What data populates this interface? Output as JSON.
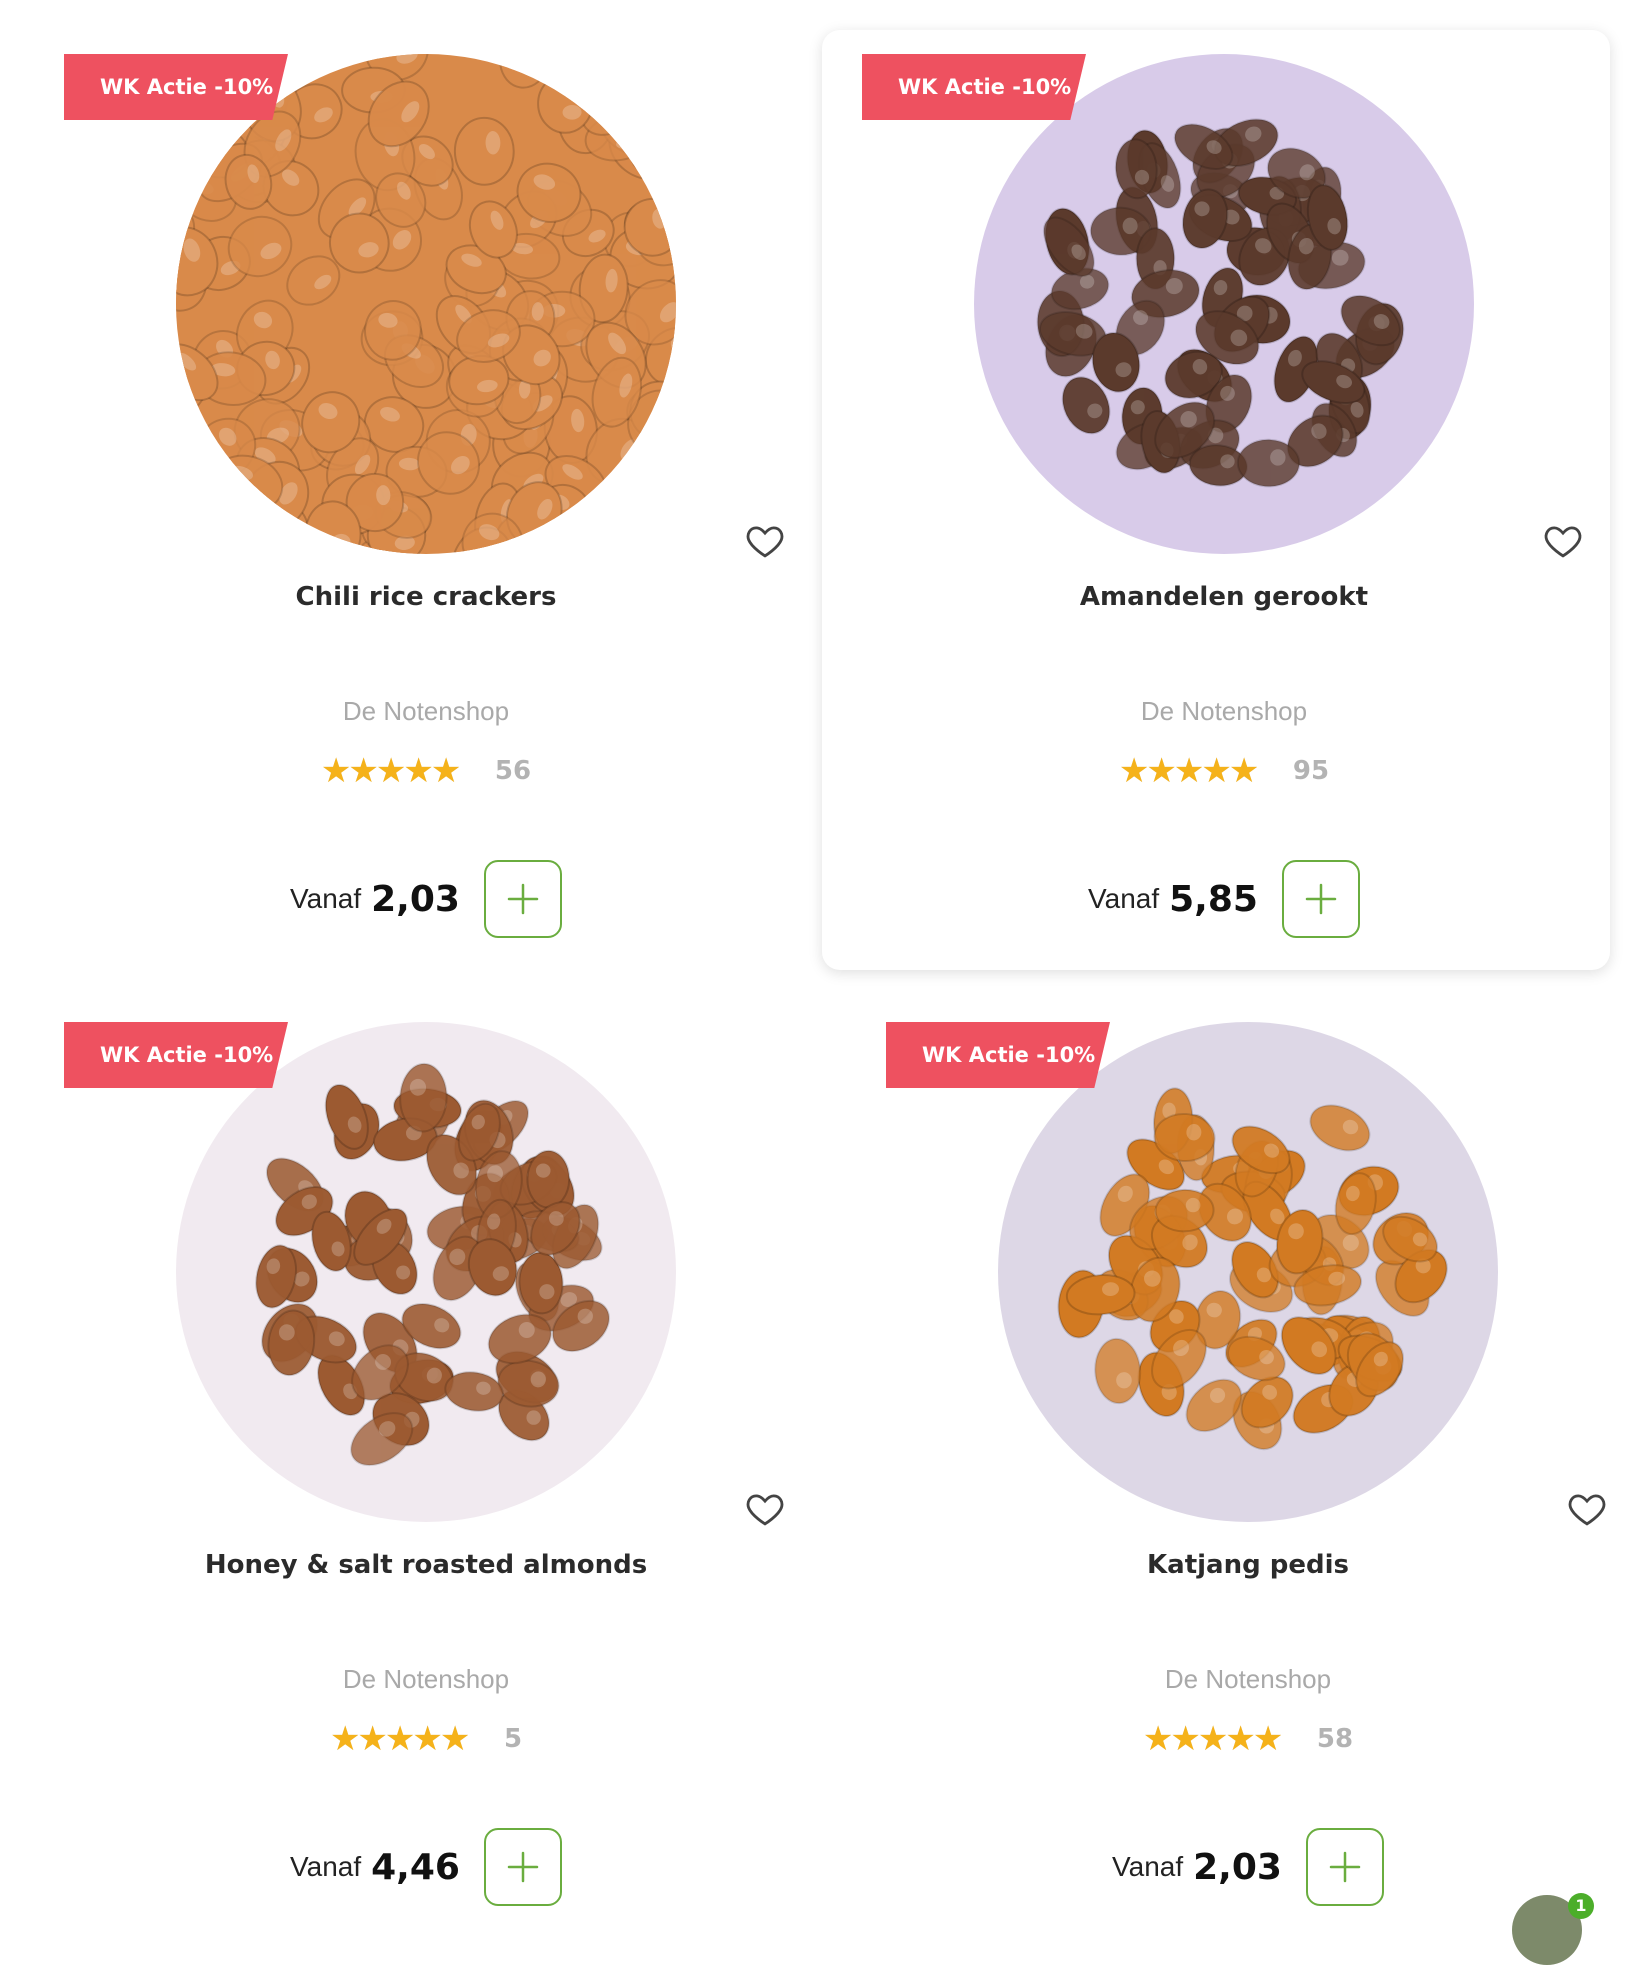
{
  "products": [
    {
      "badge": "WK Actie -10%",
      "title": "Chili rice crackers",
      "brand": "De Notenshop",
      "rating": 4.6,
      "review_count": "56",
      "price_prefix": "Vanaf",
      "price": "2,03",
      "image": "chili-rice-crackers-photo",
      "bg_color": "#ffffff",
      "food_color": "#d98a4a",
      "selected": false
    },
    {
      "badge": "WK Actie -10%",
      "title": "Amandelen gerookt",
      "brand": "De Notenshop",
      "rating": 4.6,
      "review_count": "95",
      "price_prefix": "Vanaf",
      "price": "5,85",
      "image": "smoked-almonds-photo",
      "bg_color": "#d8cbe9",
      "food_color": "#5b3a2c",
      "selected": true
    },
    {
      "badge": "WK Actie -10%",
      "title": "Honey & salt roasted almonds",
      "brand": "De Notenshop",
      "rating": 5,
      "review_count": "5",
      "price_prefix": "Vanaf",
      "price": "4,46",
      "image": "honey-salt-almonds-photo",
      "bg_color": "#f1eaf0",
      "food_color": "#9c5a31",
      "selected": false
    },
    {
      "badge": "WK Actie -10%",
      "title": "Katjang pedis",
      "brand": "De Notenshop",
      "rating": 4.6,
      "review_count": "58",
      "price_prefix": "Vanaf",
      "price": "2,03",
      "image": "katjang-pedis-photo",
      "bg_color": "#ddd7e6",
      "food_color": "#d27a22",
      "selected": false
    }
  ],
  "chat": {
    "unread": "1",
    "icon": "chat-avatar-icon"
  },
  "colors": {
    "badge": "#ee5160",
    "star": "#f5b21a",
    "add_border": "#6aad3f"
  }
}
